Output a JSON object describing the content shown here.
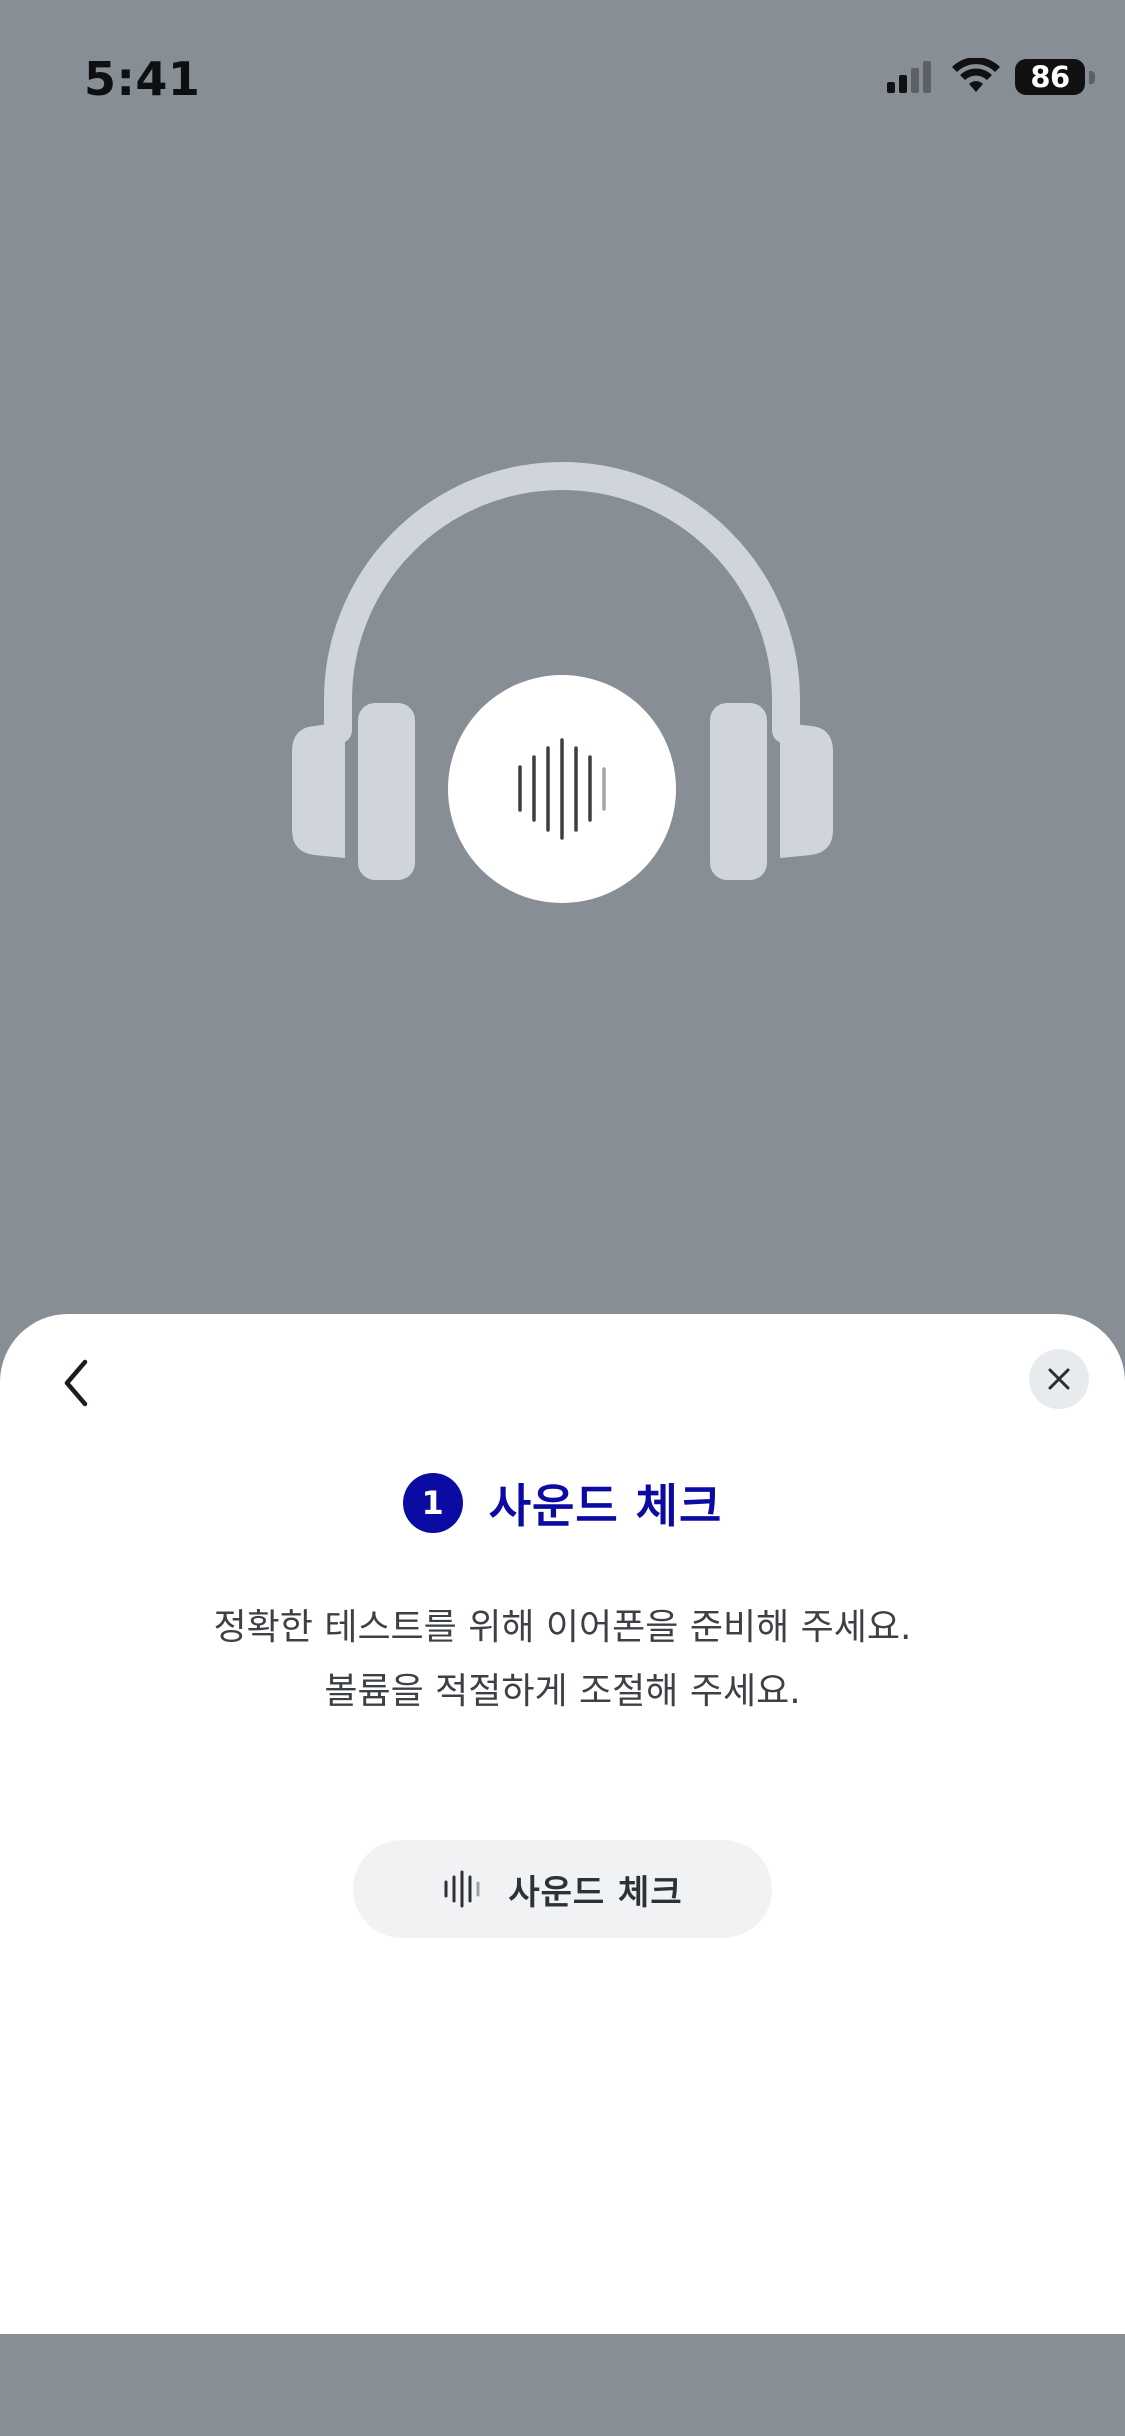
{
  "status_bar": {
    "time": "5:41",
    "battery_level": "86",
    "signal_icon": "cellular-signal-icon",
    "wifi_icon": "wifi-icon"
  },
  "hero": {
    "icon": "headphones-soundwave-illustration"
  },
  "sheet": {
    "back_icon": "chevron-left-icon",
    "close_icon": "close-icon",
    "step": {
      "number": "1",
      "title": "사운드 체크"
    },
    "description": {
      "line1": "정확한 테스트를 위해 이어폰을 준비해 주세요.",
      "line2": "볼륨을 적절하게 조절해 주세요."
    },
    "sound_check_button": {
      "label": "사운드 체크",
      "icon": "soundwave-icon"
    }
  },
  "colors": {
    "background_overlay": "#878e96",
    "accent": "#0b0ba3",
    "sheet": "#ffffff",
    "button_bg": "#f1f2f4"
  }
}
